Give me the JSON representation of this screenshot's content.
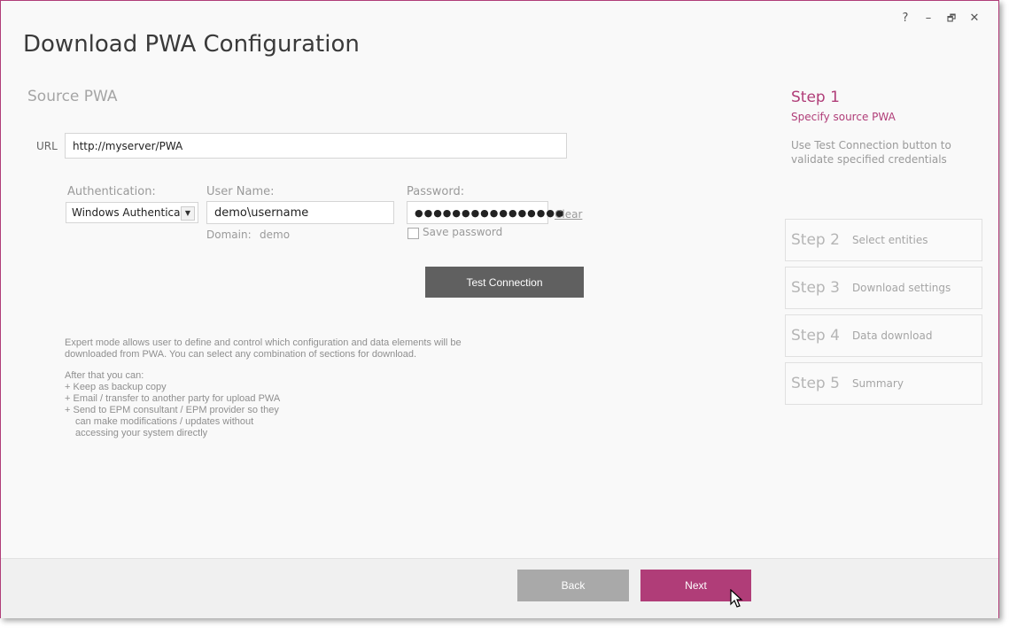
{
  "window": {
    "title": "Download PWA Configuration",
    "controls": {
      "help": "?",
      "minimize": "–",
      "restore": "🗗",
      "close": "✕"
    }
  },
  "source": {
    "section_title": "Source PWA",
    "url_label": "URL",
    "url_value": "http://myserver/PWA",
    "auth_label": "Authentication:",
    "auth_value": "Windows Authentication",
    "username_label": "User Name:",
    "username_value": "demo\\username",
    "domain_label": "Domain:",
    "domain_value": "demo",
    "password_label": "Password:",
    "password_value": "●●●●●●●●●●●●●●●●",
    "clear_label": "Clear",
    "save_password_label": "Save password",
    "test_connection_label": "Test Connection"
  },
  "description": {
    "para1": "Expert mode allows user to define and control which configuration and data elements will be downloaded from PWA. You can select any combination of sections for download.",
    "intro": "After that you can:",
    "item1": "+ Keep as backup copy",
    "item2": "+ Email / transfer to another party for upload PWA",
    "item3": "+ Send to EPM consultant / EPM provider so they",
    "item3b": "can make modifications / updates without",
    "item3c": "accessing your system directly"
  },
  "steps": {
    "current": {
      "title": "Step 1",
      "subtitle": "Specify source PWA",
      "description": "Use Test Connection button to validate specified credentials"
    },
    "items": [
      {
        "num": "Step 2",
        "name": "Select entities"
      },
      {
        "num": "Step 3",
        "name": "Download settings"
      },
      {
        "num": "Step 4",
        "name": "Data download"
      },
      {
        "num": "Step 5",
        "name": "Summary"
      }
    ]
  },
  "footer": {
    "back_label": "Back",
    "next_label": "Next"
  }
}
